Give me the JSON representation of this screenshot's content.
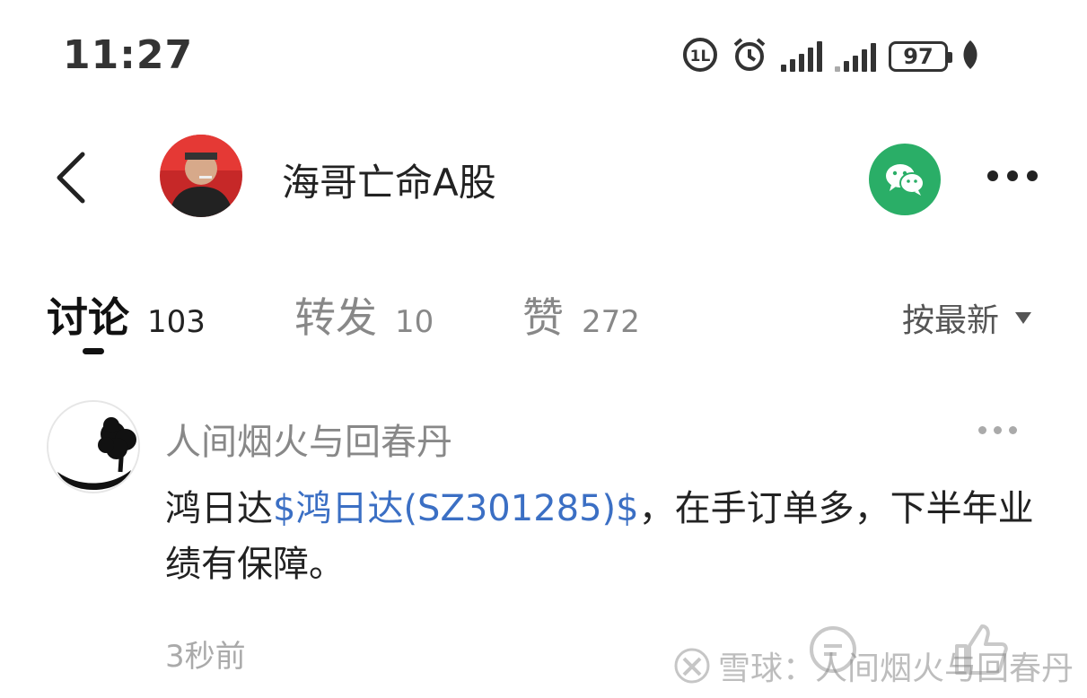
{
  "status_bar": {
    "time": "11:27",
    "battery": "97",
    "icons": [
      "hd-icon",
      "alarm-icon",
      "signal-icon",
      "signal-icon-2",
      "battery-icon",
      "charging-leaf-icon"
    ]
  },
  "header": {
    "title": "海哥亡命A股",
    "icons": [
      "back-icon",
      "wechat-icon",
      "more-icon"
    ]
  },
  "tabs": [
    {
      "label": "讨论",
      "count": "103",
      "active": true
    },
    {
      "label": "转发",
      "count": "10",
      "active": false
    },
    {
      "label": "赞",
      "count": "272",
      "active": false
    }
  ],
  "sort": {
    "label": "按最新"
  },
  "post": {
    "author": "人间烟火与回春丹",
    "text_prefix": "鸿日达",
    "stock_link": "$鸿日达(SZ301285)$",
    "text_suffix": "，在手订单多，下半年业绩有保障。",
    "time": "3秒前"
  },
  "watermark": {
    "text": "雪球：人间烟火与回春丹"
  },
  "colors": {
    "accent_link": "#3b6fc4",
    "wechat_green": "#2aae67",
    "muted_text": "#888888"
  }
}
